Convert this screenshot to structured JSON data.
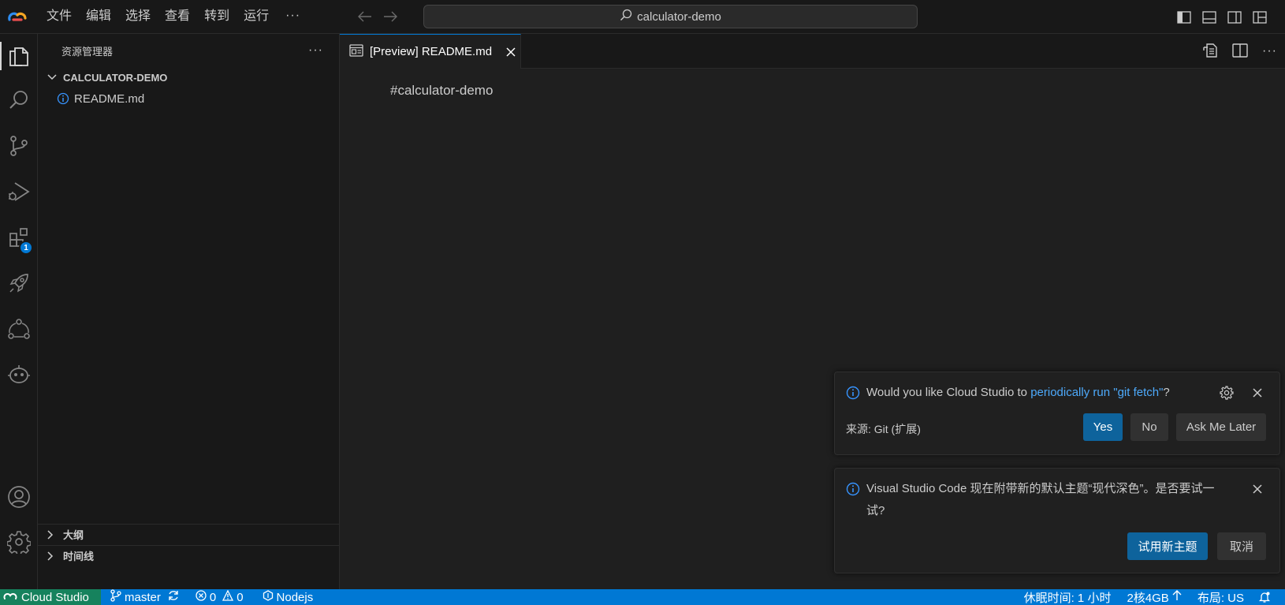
{
  "titlebar": {
    "menus": [
      "文件",
      "编辑",
      "选择",
      "查看",
      "转到",
      "运行"
    ],
    "more": "···",
    "search_text": "calculator-demo"
  },
  "activitybar": {
    "items": [
      "explorer-icon",
      "search-icon",
      "source-control-icon",
      "run-debug-icon",
      "extensions-icon",
      "rocket-icon",
      "share-icon",
      "robot-icon"
    ],
    "extensions_badge": "1",
    "bottom": [
      "account-icon",
      "settings-icon"
    ]
  },
  "sidebar": {
    "title": "资源管理器",
    "more": "···",
    "root_folder": "CALCULATOR-DEMO",
    "files": [
      "README.md"
    ],
    "outline_label": "大纲",
    "timeline_label": "时间线"
  },
  "editor": {
    "tab_label": "[Preview] README.md",
    "content": "#calculator-demo"
  },
  "notifications": {
    "git_fetch": {
      "prefix": "Would you like Cloud Studio to ",
      "link": "periodically run \"git fetch\"",
      "suffix": "?",
      "source": "来源: Git (扩展)",
      "buttons": [
        "Yes",
        "No",
        "Ask Me Later"
      ]
    },
    "theme": {
      "line1": "Visual Studio Code 现在附带新的默认主题“现代深色”。是否要试一",
      "line2": "试?",
      "buttons": [
        "试用新主题",
        "取消"
      ]
    }
  },
  "statusbar": {
    "remote": "Cloud Studio",
    "branch": "master",
    "errors": "0",
    "warnings": "0",
    "runtime": "Nodejs",
    "sleep": "休眠时间: 1 小时",
    "resources": "2核4GB",
    "layout": "布局: US"
  },
  "colors": {
    "accent": "#0078d4",
    "remote": "#16825d",
    "link": "#4daafc",
    "primary_button": "#0e639c"
  }
}
